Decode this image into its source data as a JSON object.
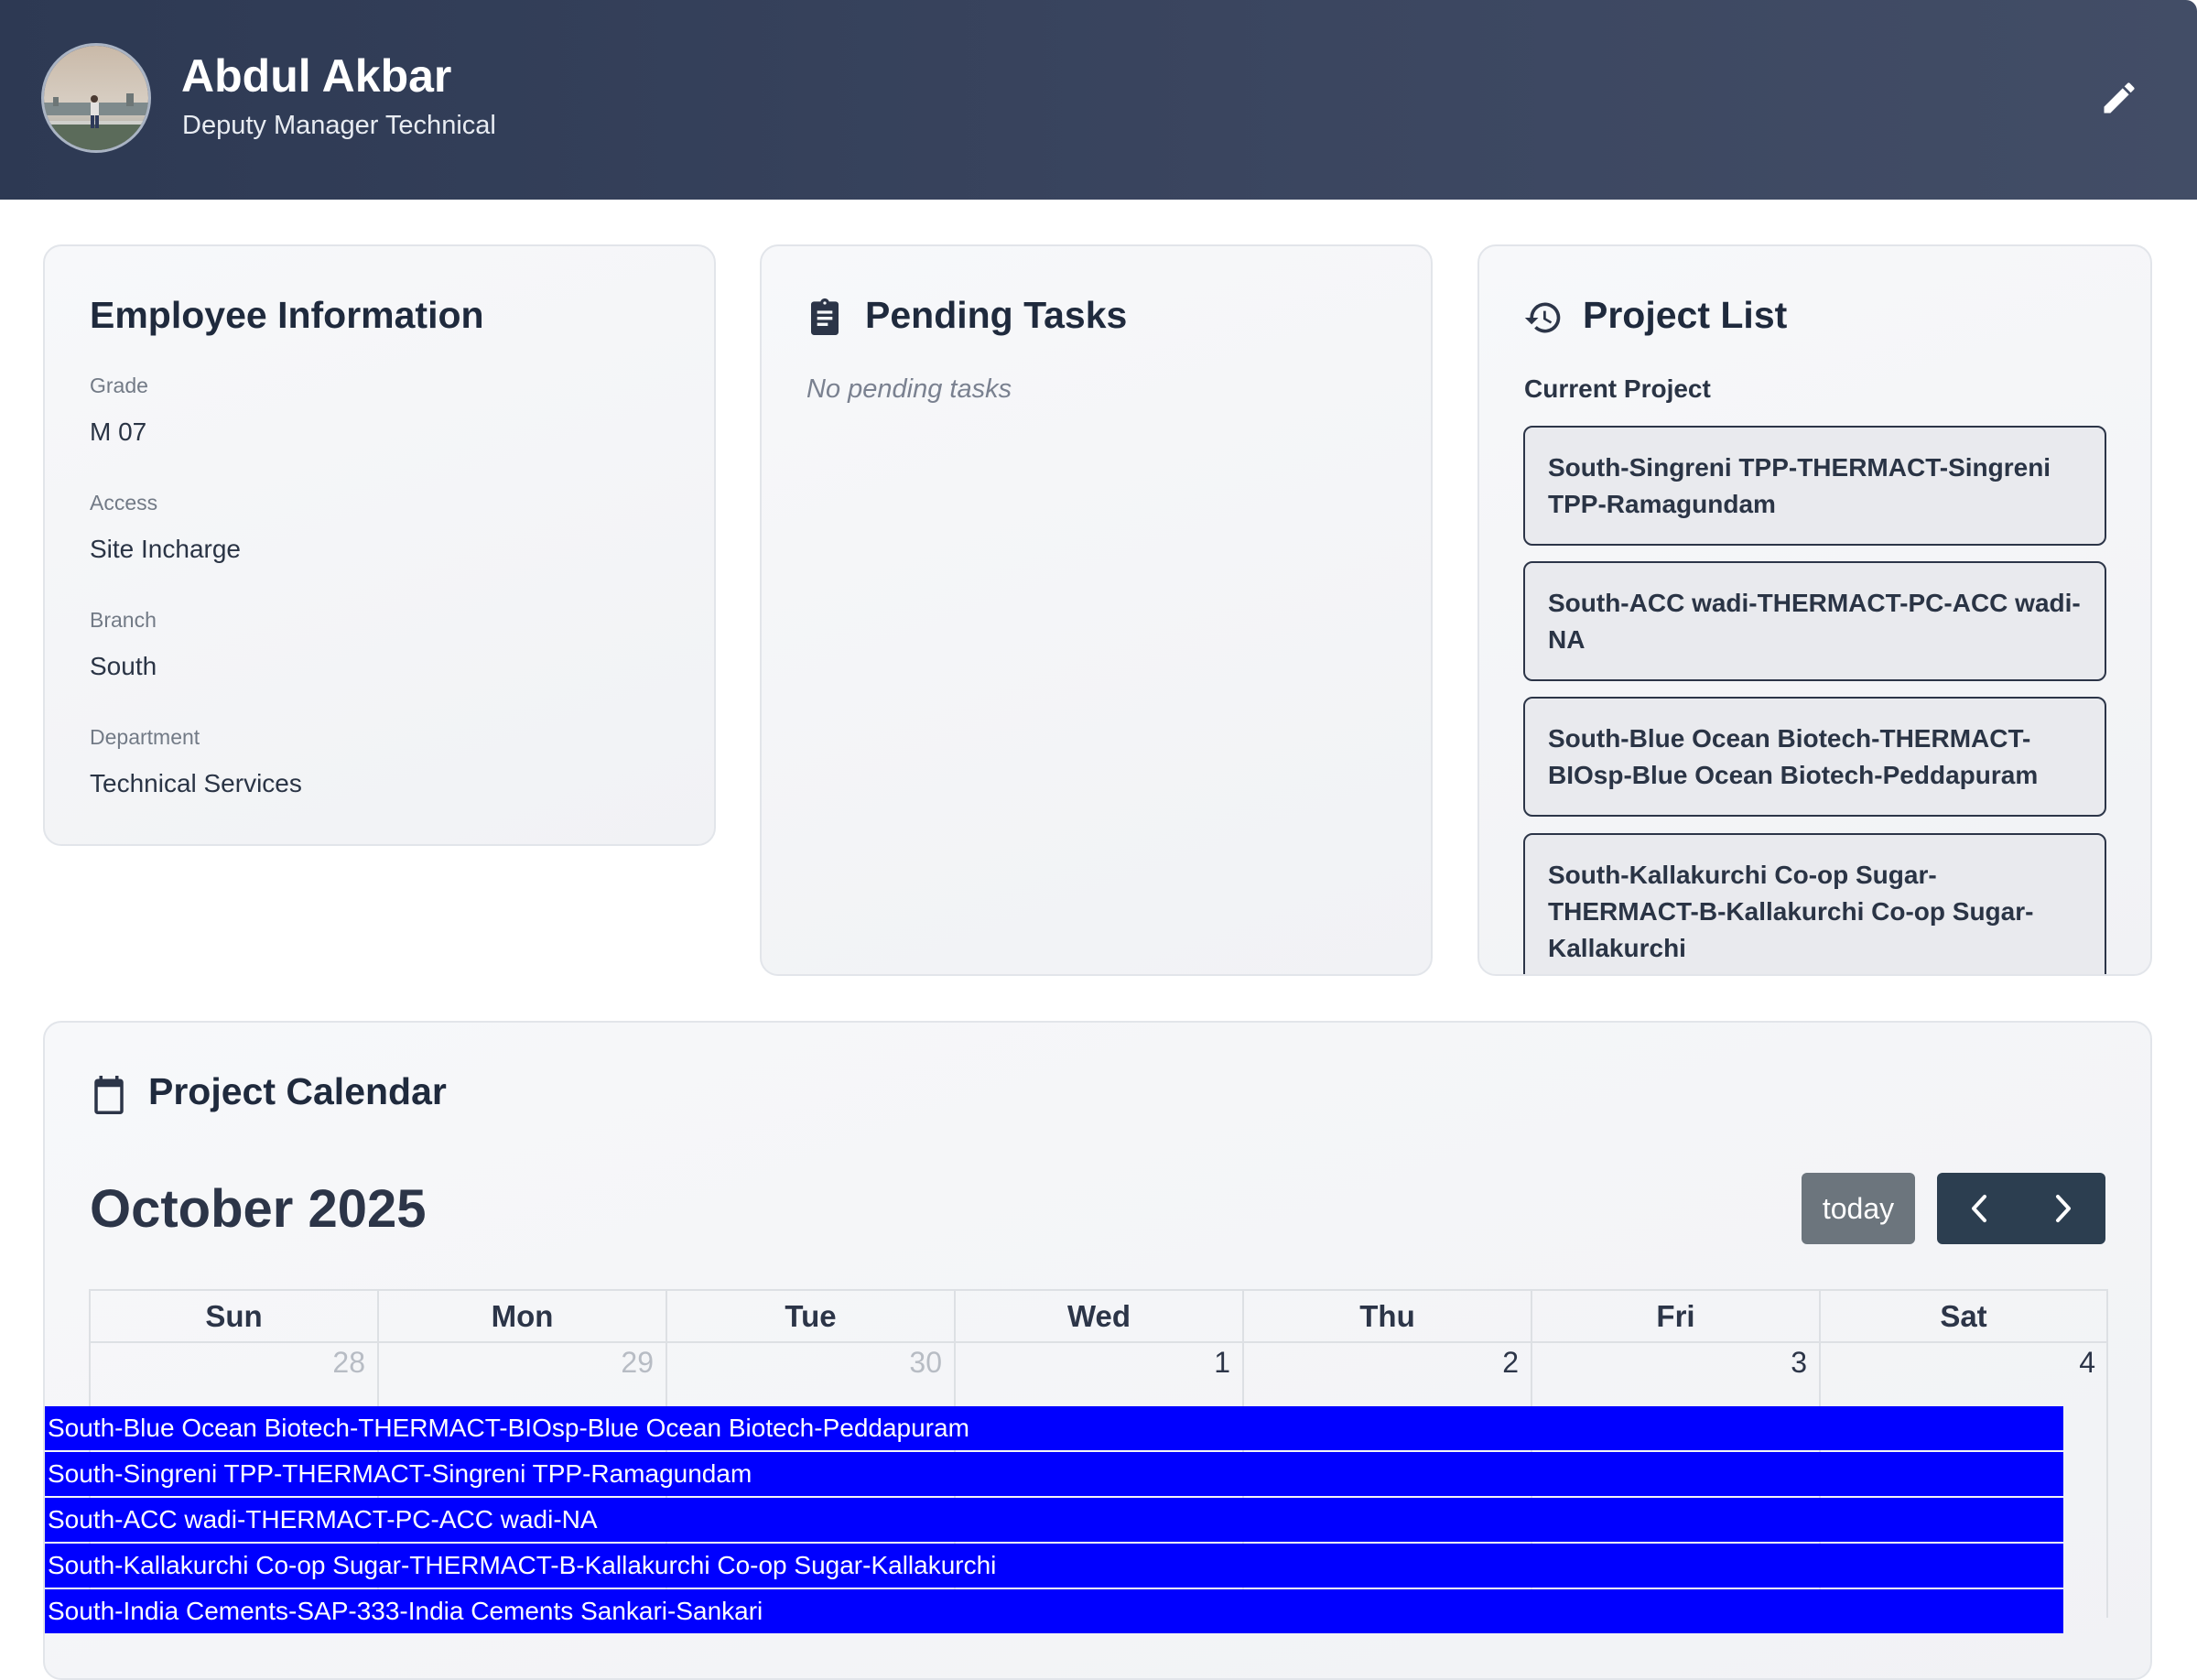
{
  "profile": {
    "name": "Abdul Akbar",
    "role": "Deputy Manager Technical"
  },
  "employee_info": {
    "title": "Employee Information",
    "fields": [
      {
        "label": "Grade",
        "value": "M 07"
      },
      {
        "label": "Access",
        "value": "Site Incharge"
      },
      {
        "label": "Branch",
        "value": "South"
      },
      {
        "label": "Department",
        "value": "Technical Services"
      }
    ]
  },
  "pending_tasks": {
    "title": "Pending Tasks",
    "empty_text": "No pending tasks"
  },
  "project_list": {
    "title": "Project List",
    "current_label": "Current Project",
    "items": [
      "South-Singreni TPP-THERMACT-Singreni TPP-Ramagundam",
      "South-ACC wadi-THERMACT-PC-ACC wadi-NA",
      "South-Blue Ocean Biotech-THERMACT-BIOsp-Blue Ocean Biotech-Peddapuram",
      "South-Kallakurchi Co-op Sugar-THERMACT-B-Kallakurchi Co-op Sugar-Kallakurchi"
    ]
  },
  "calendar": {
    "title": "Project Calendar",
    "month": "October 2025",
    "today_label": "today",
    "weekdays": [
      "Sun",
      "Mon",
      "Tue",
      "Wed",
      "Thu",
      "Fri",
      "Sat"
    ],
    "first_week": [
      "28",
      "29",
      "30",
      "1",
      "2",
      "3",
      "4"
    ],
    "events": [
      "South-Blue Ocean Biotech-THERMACT-BIOsp-Blue Ocean Biotech-Peddapuram",
      "South-Singreni TPP-THERMACT-Singreni TPP-Ramagundam",
      "South-ACC wadi-THERMACT-PC-ACC wadi-NA",
      "South-Kallakurchi Co-op Sugar-THERMACT-B-Kallakurchi Co-op Sugar-Kallakurchi",
      "South-India Cements-SAP-333-India Cements Sankari-Sankari"
    ],
    "event_color": "#0000ff"
  },
  "icons": {
    "edit": "pencil-icon",
    "pending": "clipboard-icon",
    "projects": "history-icon",
    "calendar": "calendar-icon",
    "prev": "chevron-left-icon",
    "next": "chevron-right-icon"
  }
}
